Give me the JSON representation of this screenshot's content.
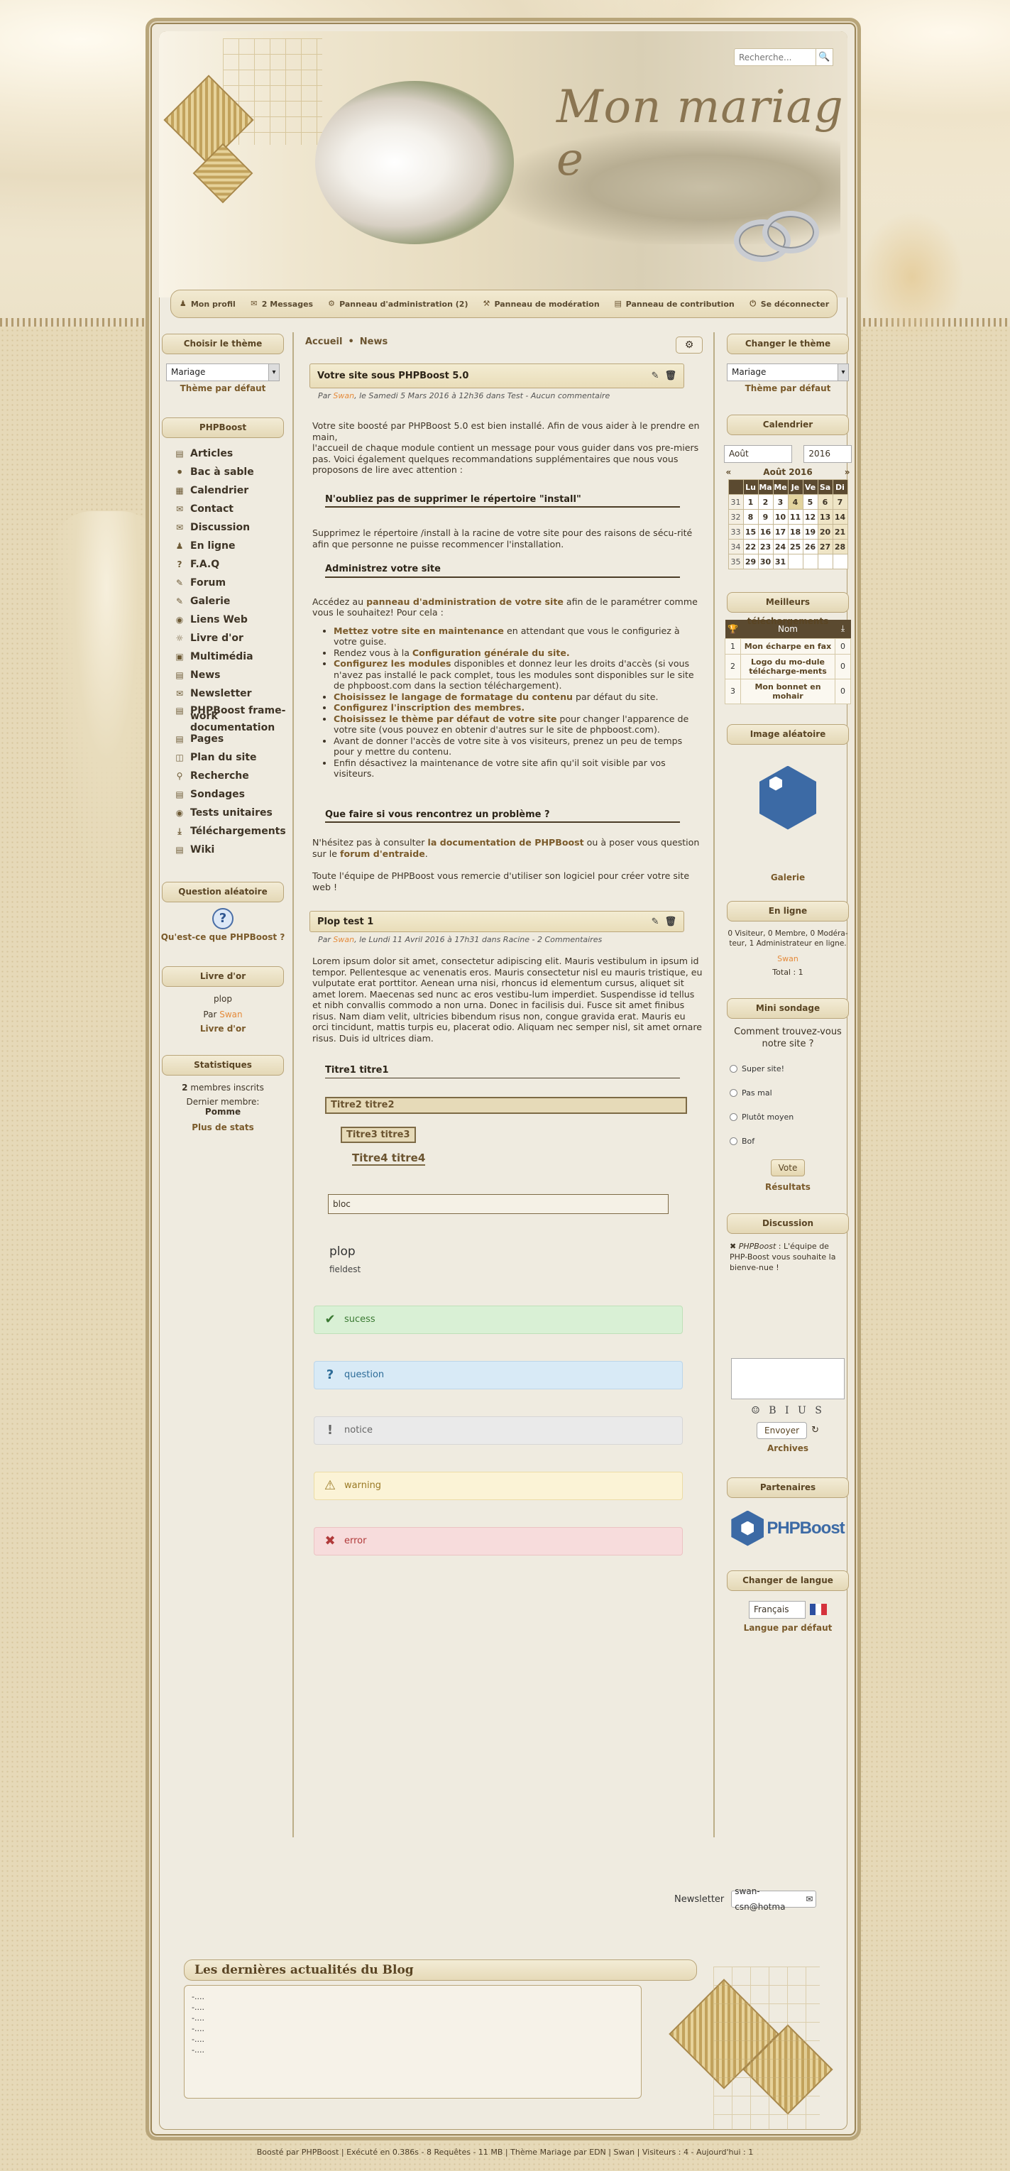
{
  "header": {
    "logo_title": "Mon mariag e",
    "search_placeholder": "Recherche...",
    "search_icon": "search-icon",
    "userbar": [
      "Mon profil",
      "2 Messages",
      "Panneau d'administration (2)",
      "Panneau de modération",
      "Panneau de contribution",
      "Se déconnecter"
    ]
  },
  "left": {
    "theme_title": "Choisir le thème",
    "theme_value": "Mariage",
    "theme_default": "Thème par défaut",
    "menu_title": "PHPBoost",
    "menu": [
      "Articles",
      "Bac à sable",
      "Calendrier",
      "Contact",
      "Discussion",
      "En ligne",
      "F.A.Q",
      "Forum",
      "Galerie",
      "Liens Web",
      "Livre d'or",
      "Multimédia",
      "News",
      "Newsletter",
      "PHPBoost frame-",
      "work documentation",
      "Pages",
      "Plan du site",
      "Recherche",
      "Sondages",
      "Tests unitaires",
      "Téléchargements",
      "Wiki"
    ],
    "question_title": "Question aléatoire",
    "question_text": "Qu'est-ce que PHPBoost ?",
    "guestbook_title": "Livre d'or",
    "guestbook_msg": "plop",
    "guestbook_by": "Par",
    "guestbook_author": "Swan",
    "guestbook_link": "Livre d'or",
    "stats_title": "Statistiques",
    "stats_members": "2",
    "stats_members_label": "membres inscrits",
    "stats_last_label": "Dernier membre:",
    "stats_last": "Pomme",
    "stats_more": "Plus de stats"
  },
  "main": {
    "breadcrumb": [
      "Accueil",
      "News"
    ],
    "post1": {
      "title": "Votre site sous PHPBoost 5.0",
      "meta_par": "Par",
      "meta_author": "Swan",
      "meta_rest": ", le Samedi 5 Mars 2016 à 12h36 dans Test - Aucun commentaire",
      "p1": "Votre site boosté par PHPBoost 5.0 est bien installé. Afin de vous aider à le prendre en main,",
      "p1b": "l'accueil de chaque module contient un message pour vous guider dans vos pre-miers pas. Voici également quelques recommandations supplémentaires que nous vous proposons de lire avec attention :",
      "h1": "N'oubliez pas de supprimer le répertoire \"install\"",
      "p2": "Supprimez le répertoire /install à la racine de votre site pour des raisons de sécu-rité afin que personne ne puisse recommencer l'installation.",
      "h2": "Administrez votre site",
      "p3a": "Accédez au ",
      "p3b": "panneau d'administration de votre site",
      "p3c": " afin de le paramétrer comme vous le souhaitez! Pour cela :",
      "list": [
        [
          "Mettez votre site en maintenance",
          " en attendant que vous le configuriez à votre guise."
        ],
        [
          "Rendez vous à la ",
          "Configuration générale du site."
        ],
        [
          "Configurez les modules",
          " disponibles et donnez leur les droits d'accès (si vous n'avez pas installé le pack complet, tous les modules sont disponibles sur le site de phpboost.com dans la section téléchargement)."
        ],
        [
          "Choisissez le langage de formatage du contenu",
          " par défaut du site."
        ],
        [
          "Configurez l'inscription des membres.",
          ""
        ],
        [
          "Choisissez le thème par défaut de votre site",
          " pour changer l'apparence de votre site (vous pouvez en obtenir d'autres sur le site de phpboost.com)."
        ],
        [
          "Avant de donner l'accès de votre site à vos visiteurs, prenez un peu de temps pour y mettre du contenu.",
          ""
        ],
        [
          "Enfin ",
          "désactivez la maintenance de votre site afin qu'il soit visible par vos visiteurs."
        ]
      ],
      "h3": "Que faire si vous rencontrez un problème ?",
      "p4a": "N'hésitez pas à consulter ",
      "p4b": "la documentation de PHPBoost",
      "p4c": " ou à poser vous question sur le ",
      "p4d": "forum d'entraide",
      "p4e": ".",
      "p5": "Toute l'équipe de PHPBoost vous remercie d'utiliser son logiciel pour créer votre site web !"
    },
    "post2": {
      "title": "Plop test 1",
      "meta_par": "Par",
      "meta_author": "Swan",
      "meta_rest": ", le Lundi 11 Avril 2016 à 17h31 dans Racine - 2 Commentaires",
      "lorem": "Lorem ipsum dolor sit amet, consectetur adipiscing elit. Mauris vestibulum in ipsum id tempor. Pellentesque ac venenatis eros. Mauris consectetur nisl eu mauris tristique, eu vulputate erat porttitor. Aenean urna nisi, rhoncus id elementum cursus, aliquet sit amet lorem. Maecenas sed nunc ac eros vestibu-lum imperdiet. Suspendisse id tellus et nibh convallis commodo a non urna. Donec in facilisis dui. Fusce sit amet finibus risus. Nam diam velit, ultricies bibendum risus non, congue gravida erat. Mauris eu orci tincidunt, mattis turpis eu, placerat odio. Aliquam nec semper nisl, sit amet ornare risus. Duis id ultrices diam.",
      "t1": "Titre1 titre1",
      "t2": "Titre2 titre2",
      "t3": "Titre3 titre3",
      "t4": "Titre4 titre4",
      "bloc": "bloc",
      "fieldset_legend": "plop",
      "fieldset_body": "fieldest",
      "msgs": {
        "success": "sucess",
        "question": "question",
        "notice": "notice",
        "warning": "warning",
        "error": "error"
      }
    }
  },
  "right": {
    "theme_title": "Changer le thème",
    "theme_value": "Mariage",
    "theme_default": "Thème par défaut",
    "cal_title": "Calendrier",
    "cal_month": "Août",
    "cal_year": "2016",
    "cal_label": "Août 2016",
    "cal_days": [
      "Lu",
      "Ma",
      "Me",
      "Je",
      "Ve",
      "Sa",
      "Di"
    ],
    "cal_rows": [
      [
        "31",
        "1",
        "2",
        "3",
        "4",
        "5",
        "6",
        "7"
      ],
      [
        "32",
        "8",
        "9",
        "10",
        "11",
        "12",
        "13",
        "14"
      ],
      [
        "33",
        "15",
        "16",
        "17",
        "18",
        "19",
        "20",
        "21"
      ],
      [
        "34",
        "22",
        "23",
        "24",
        "25",
        "26",
        "27",
        "28"
      ],
      [
        "35",
        "29",
        "30",
        "31",
        "",
        "",
        "",
        ""
      ]
    ],
    "dl_title": "Meilleurs téléchargements",
    "dl_header": "Nom",
    "dl_rows": [
      [
        "1",
        "Mon écharpe en fax",
        "0"
      ],
      [
        "2",
        "Logo du mo-dule télécharge-ments",
        "0"
      ],
      [
        "3",
        "Mon bonnet en mohair",
        "0"
      ]
    ],
    "img_title": "Image aléatoire",
    "img_caption": "Galerie",
    "online_title": "En ligne",
    "online_text": "0 Visiteur, 0 Membre, 0 Modéra-teur, 1 Administrateur en ligne.",
    "online_user": "Swan",
    "online_total": "Total : 1",
    "poll_title": "Mini sondage",
    "poll_question": "Comment trouvez-vous notre site ?",
    "poll_opts": [
      "Super site!",
      "Pas mal",
      "Plutôt moyen",
      "Bof"
    ],
    "poll_vote": "Vote",
    "poll_results": "Résultats",
    "disc_title": "Discussion",
    "disc_author": "PHPBoost",
    "disc_text": " : L'équipe de PHP-Boost vous souhaite la bienve-nue !",
    "disc_bbcode": "☺ B I U S",
    "disc_send": "Envoyer",
    "disc_archives": "Archives",
    "partners_title": "Partenaires",
    "partners_logo": "PHPBoost",
    "lang_title": "Changer de langue",
    "lang_value": "Français",
    "lang_default": "Langue par défaut"
  },
  "newsletter": {
    "label": "Newsletter",
    "value": "swan-csn@hotma"
  },
  "blog": {
    "title": "Les dernières actualités du Blog",
    "items": [
      "-....",
      "-....",
      "-....",
      "-....",
      "-....",
      "-...."
    ]
  },
  "footer": "Boosté par PHPBoost | Exécuté en 0.386s - 8 Requêtes - 11 MB | Thème Mariage par EDN | Swan | Visiteurs : 4 - Aujourd'hui : 1",
  "colors": {
    "accent": "#7a5a2a",
    "frame": "#b8a57a",
    "dark": "#5b4a30",
    "author": "#e48a3a"
  }
}
